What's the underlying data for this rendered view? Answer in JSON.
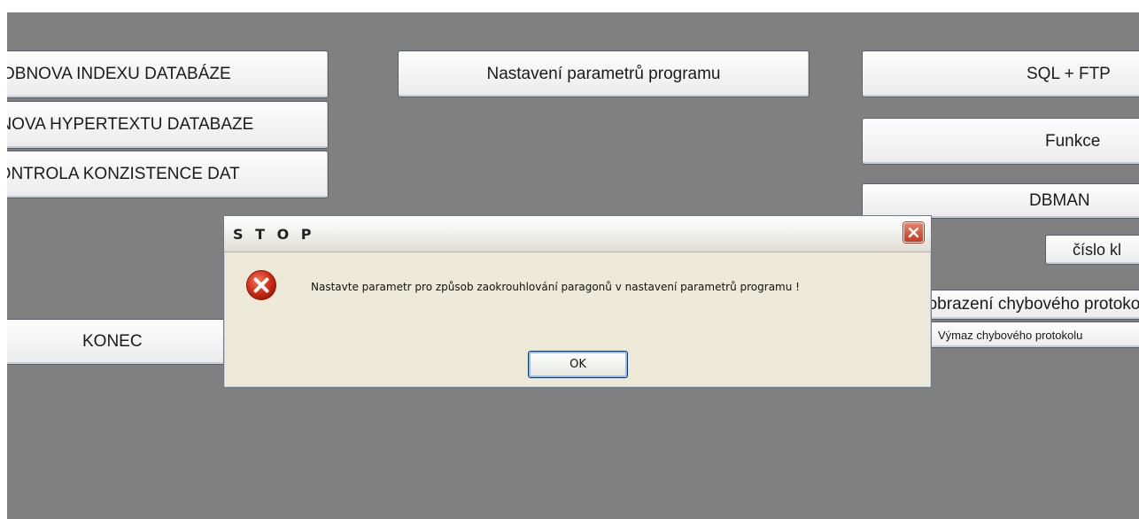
{
  "buttons": {
    "obnova_indexu": "OBNOVA INDEXU DATABÁZE",
    "obnova_hypertextu": "OBNOVA HYPERTEXTU DATABAZE",
    "kontrola_konzistence": "KONTROLA KONZISTENCE DAT",
    "konec": "KONEC",
    "nastaveni_parametru": "Nastavení parametrů programu",
    "sql_ftp": "SQL + FTP",
    "funkce": "Funkce",
    "dbman": "DBMAN",
    "cislo_klavesnice": "číslo kl",
    "zobrazeni_protokolu": "Zobrazení chybového protokolu",
    "vymaz_protokolu": "Výmaz chybového protokolu"
  },
  "dialog": {
    "title": "S T O P",
    "message": "Nastavte parametr pro způsob zaokrouhlování paragonů v nastavení parametrů programu !",
    "ok_label": "OK"
  },
  "icons": {
    "error": "error-icon",
    "close": "close-icon"
  },
  "colors": {
    "background": "#808080",
    "dialog_bg": "#ece9d8",
    "error_red": "#d52f17",
    "close_red": "#c8391e"
  }
}
